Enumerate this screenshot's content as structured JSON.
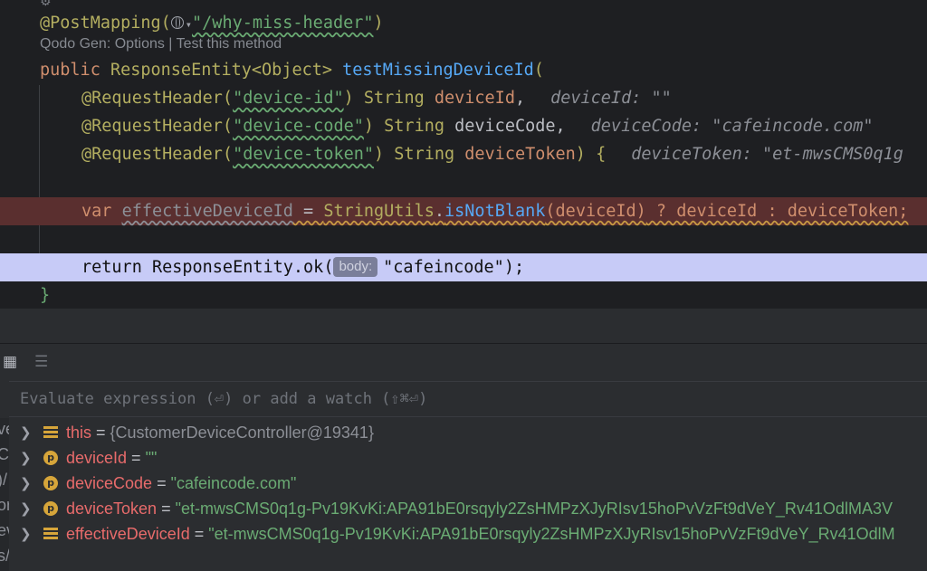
{
  "editor": {
    "mapping_annotation": "@PostMapping(",
    "mapping_path": "\"/why-miss-header\"",
    "mapping_close": ")",
    "codelens": "Qodo Gen: Options | Test this method",
    "sig_public": "public ",
    "sig_type": "ResponseEntity<Object> ",
    "sig_name": "testMissingDeviceId",
    "sig_open": "(",
    "params": [
      {
        "annotation": "@RequestHeader(",
        "header": "\"device-id\"",
        "close": ") ",
        "type": "String ",
        "name": "deviceId",
        "sep": ",",
        "hint": "deviceId: \"\""
      },
      {
        "annotation": "@RequestHeader(",
        "header": "\"device-code\"",
        "close": ") ",
        "type": "String ",
        "name": "deviceCode",
        "sep": ",",
        "hint": "deviceCode: \"cafeincode.com\""
      },
      {
        "annotation": "@RequestHeader(",
        "header": "\"device-token\"",
        "close": ") ",
        "type": "String ",
        "name": "deviceToken",
        "sep": ") {",
        "hint": "deviceToken: \"et-mwsCMS0q1g"
      }
    ],
    "var_line": {
      "kw": "var ",
      "name": "effectiveDeviceId",
      "eq": " = ",
      "cls": "StringUtils",
      "dot": ".",
      "method": "isNotBlank",
      "arg": "(deviceId)",
      "tern": " ? deviceId : deviceToken;"
    },
    "return_line": {
      "kw": "return ",
      "call": "ResponseEntity.ok(",
      "hint": "body:",
      "arg": "\"cafeincode\"",
      "close": ");"
    },
    "closing_brace": "}"
  },
  "debug": {
    "eval_placeholder": "Evaluate expression (⏎) or add a watch (⇧⌘⏎)",
    "gutter_text": [
      "ve",
      "CC",
      ")/",
      "or",
      "ev",
      "s/"
    ],
    "variables": [
      {
        "name": "this",
        "icon": "object-icon",
        "eq": " = ",
        "value": "{CustomerDeviceController@19341}",
        "kind": "object"
      },
      {
        "name": "deviceId",
        "icon": "param-icon",
        "eq": " = ",
        "value": "\"\"",
        "kind": "string"
      },
      {
        "name": "deviceCode",
        "icon": "param-icon",
        "eq": " = ",
        "value": "\"cafeincode.com\"",
        "kind": "string"
      },
      {
        "name": "deviceToken",
        "icon": "param-icon",
        "eq": " = ",
        "value": "\"et-mwsCMS0q1g-Pv19KvKi:APA91bE0rsqyly2ZsHMPzXJyRIsv15hoPvVzFt9dVeY_Rv41OdlMA3V",
        "kind": "string"
      },
      {
        "name": "effectiveDeviceId",
        "icon": "object-icon",
        "eq": " = ",
        "value": "\"et-mwsCMS0q1g-Pv19KvKi:APA91bE0rsqyly2ZsHMPzXJyRIsv15hoPvVzFt9dVeY_Rv41OdlM",
        "kind": "string"
      }
    ]
  },
  "colors": {
    "editor_bg": "#1e1f22",
    "error_line": "#5a2f2f",
    "exec_line": "#c7cbf7",
    "string": "#6aab73",
    "annotation": "#b3ae60",
    "keyword": "#cf8e6d",
    "function": "#56a8f5",
    "var_name": "#e86b6b"
  }
}
